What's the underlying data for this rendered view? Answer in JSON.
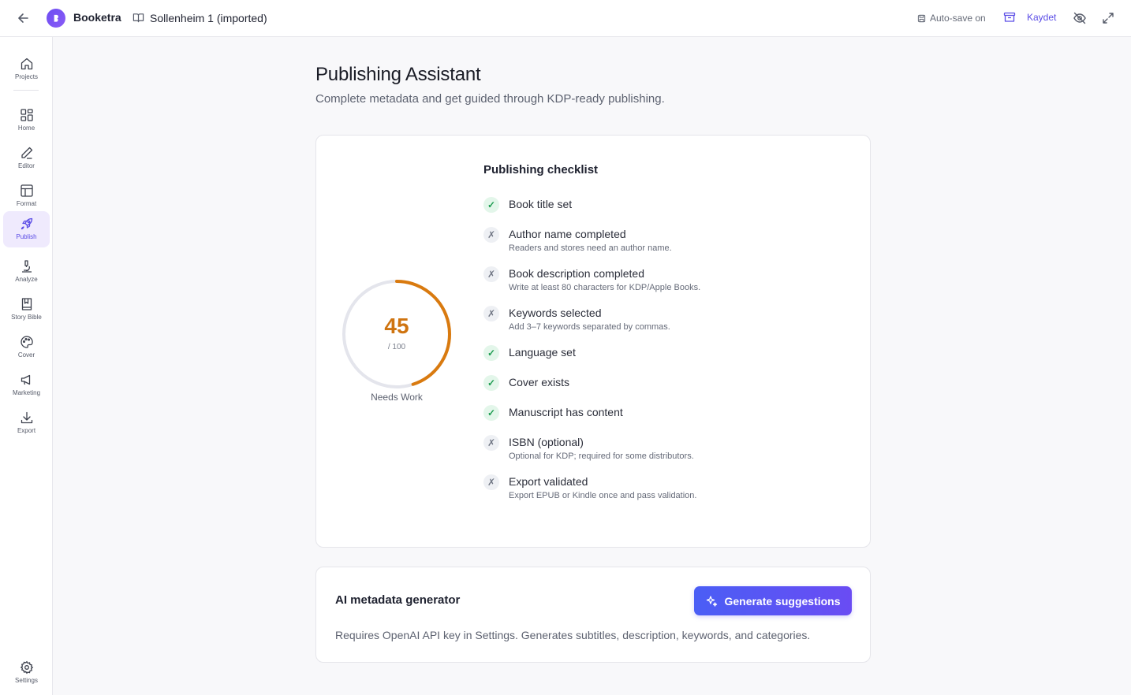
{
  "header": {
    "app_name": "Booketra",
    "project_name": "Sollenheim 1 (imported)",
    "autosave_label": "Auto-save on",
    "save_label": "Kaydet"
  },
  "sidebar": {
    "items": [
      {
        "label": "Projects",
        "icon": "home-icon"
      },
      {
        "label": "Home",
        "icon": "grid-icon"
      },
      {
        "label": "Editor",
        "icon": "pen-icon"
      },
      {
        "label": "Format",
        "icon": "layout-icon"
      },
      {
        "label": "Publish",
        "icon": "rocket-icon",
        "active": true
      },
      {
        "label": "Analyze",
        "icon": "microscope-icon"
      },
      {
        "label": "Story Bible",
        "icon": "bookmark-book-icon"
      },
      {
        "label": "Cover",
        "icon": "palette-icon"
      },
      {
        "label": "Marketing",
        "icon": "megaphone-icon"
      },
      {
        "label": "Export",
        "icon": "download-icon"
      }
    ],
    "settings_label": "Settings"
  },
  "main": {
    "title": "Publishing Assistant",
    "subtitle": "Complete metadata and get guided through KDP-ready publishing."
  },
  "score": {
    "value": "45",
    "max_label": "/ 100",
    "status": "Needs Work",
    "fraction": 0.45,
    "color": "#d97a0f"
  },
  "checklist": {
    "title": "Publishing checklist",
    "items": [
      {
        "label": "Book title set",
        "done": true,
        "desc": ""
      },
      {
        "label": "Author name completed",
        "done": false,
        "desc": "Readers and stores need an author name."
      },
      {
        "label": "Book description completed",
        "done": false,
        "desc": "Write at least 80 characters for KDP/Apple Books."
      },
      {
        "label": "Keywords selected",
        "done": false,
        "desc": "Add 3–7 keywords separated by commas."
      },
      {
        "label": "Language set",
        "done": true,
        "desc": ""
      },
      {
        "label": "Cover exists",
        "done": true,
        "desc": ""
      },
      {
        "label": "Manuscript has content",
        "done": true,
        "desc": ""
      },
      {
        "label": "ISBN (optional)",
        "done": false,
        "desc": "Optional for KDP; required for some distributors."
      },
      {
        "label": "Export validated",
        "done": false,
        "desc": "Export EPUB or Kindle once and pass validation."
      }
    ],
    "done_glyph": "✓",
    "todo_glyph": "✗"
  },
  "ai": {
    "title": "AI metadata generator",
    "button_label": "Generate suggestions",
    "description": "Requires OpenAI API key in Settings. Generates subtitles, description, keywords, and categories."
  },
  "colors": {
    "accent": "#5b4de6",
    "score": "#d97a0f",
    "done": "#1f9d52"
  }
}
